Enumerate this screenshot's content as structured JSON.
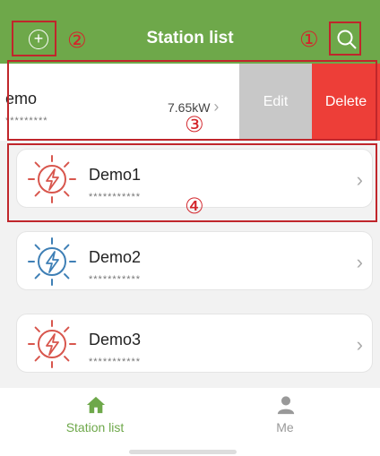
{
  "header": {
    "title": "Station list"
  },
  "annotations": {
    "one": "①",
    "two": "②",
    "three": "③",
    "four": "④"
  },
  "swipe_row": {
    "name": "emo",
    "stars": "*********",
    "power": "7.65kW",
    "chevron": "›",
    "edit_label": "Edit",
    "delete_label": "Delete"
  },
  "stations": [
    {
      "name": "Demo1",
      "stars": "***********",
      "status_color": "#d8564d"
    },
    {
      "name": "Demo2",
      "stars": "***********",
      "status_color": "#3e7fb5"
    },
    {
      "name": "Demo3",
      "stars": "***********",
      "status_color": "#d8564d"
    }
  ],
  "chevron": "›",
  "tabbar": {
    "items": [
      {
        "label": "Station list",
        "icon": "home-icon",
        "color": "#6ea84a"
      },
      {
        "label": "Me",
        "icon": "person-icon",
        "color": "#999999"
      }
    ]
  },
  "colors": {
    "accent": "#6ea84a",
    "delete": "#ed3e38",
    "edit": "#c8c8c8",
    "annotation": "#d3252b"
  }
}
